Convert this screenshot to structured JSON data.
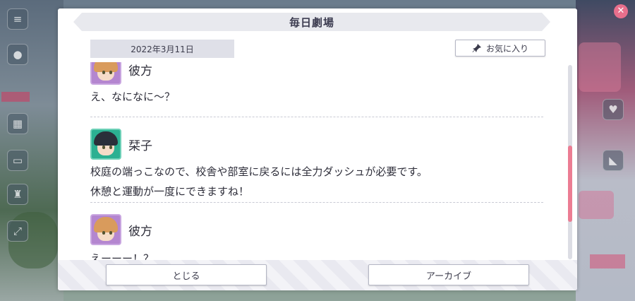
{
  "dialog": {
    "title": "毎日劇場",
    "date": "2022年3月11日",
    "favorite_label": "お気に入り",
    "favorite_icon": "pin-icon",
    "close_label": "とじる",
    "archive_label": "アーカイブ"
  },
  "messages": [
    {
      "name": "彼方",
      "lines": [
        "え、なになに～？"
      ],
      "avatar": "kanata"
    },
    {
      "name": "栞子",
      "lines": [
        "校庭の端っこなので、校舎や部室に戻るには全力ダッシュが必要です。",
        "休憩と運動が一度にできますね！"
      ],
      "avatar": "shioriko"
    },
    {
      "name": "彼方",
      "lines": [
        "えーーー！？"
      ],
      "avatar": "kanata"
    }
  ],
  "scroll": {
    "position": 0.68
  },
  "colors": {
    "accent": "#ec7d93",
    "title_bg": "#e8e9ee",
    "date_bg": "#dfe0e8"
  }
}
